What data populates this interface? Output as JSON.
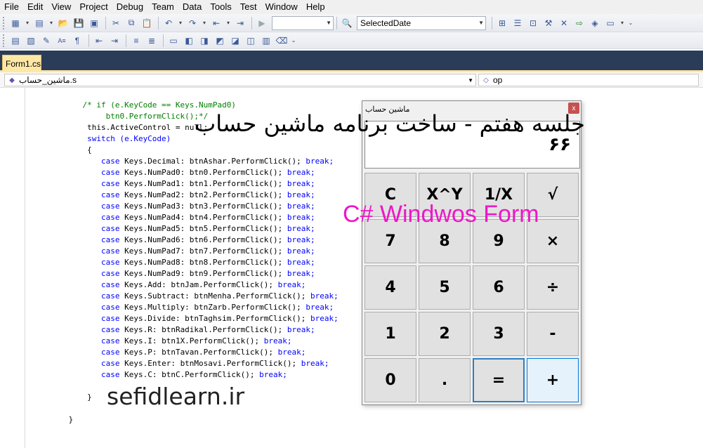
{
  "menu": [
    "File",
    "Edit",
    "View",
    "Project",
    "Debug",
    "Team",
    "Data",
    "Tools",
    "Test",
    "Window",
    "Help"
  ],
  "toolbar": {
    "property_combo_value": "SelectedDate"
  },
  "tab": {
    "label": "Form1.cs"
  },
  "nav": {
    "left_value": "ماشین_حساب.s",
    "right_value": "op"
  },
  "code_lines": [
    {
      "kind": "cmt",
      "text": "            /* if (e.KeyCode == Keys.NumPad0)"
    },
    {
      "kind": "cmt",
      "text": "                 btn0.PerformClick();*/"
    },
    {
      "kind": "plain",
      "text": "             this.ActiveControl = null;"
    },
    {
      "kind": "switch",
      "text": "             switch (e.KeyCode)"
    },
    {
      "kind": "plain",
      "text": "             {"
    },
    {
      "kind": "case",
      "text": "Keys.Decimal: btnAshar.PerformClick(); "
    },
    {
      "kind": "case",
      "text": "Keys.NumPad0: btn0.PerformClick(); "
    },
    {
      "kind": "case",
      "text": "Keys.NumPad1: btn1.PerformClick(); "
    },
    {
      "kind": "case",
      "text": "Keys.NumPad2: btn2.PerformClick(); "
    },
    {
      "kind": "case",
      "text": "Keys.NumPad3: btn3.PerformClick(); "
    },
    {
      "kind": "case",
      "text": "Keys.NumPad4: btn4.PerformClick(); "
    },
    {
      "kind": "case",
      "text": "Keys.NumPad5: btn5.PerformClick(); "
    },
    {
      "kind": "case",
      "text": "Keys.NumPad6: btn6.PerformClick(); "
    },
    {
      "kind": "case",
      "text": "Keys.NumPad7: btn7.PerformClick(); "
    },
    {
      "kind": "case",
      "text": "Keys.NumPad8: btn8.PerformClick(); "
    },
    {
      "kind": "case",
      "text": "Keys.NumPad9: btn9.PerformClick(); "
    },
    {
      "kind": "case",
      "text": "Keys.Add: btnJam.PerformClick(); "
    },
    {
      "kind": "case",
      "text": "Keys.Subtract: btnMenha.PerformClick(); "
    },
    {
      "kind": "case",
      "text": "Keys.Multiply: btnZarb.PerformClick(); "
    },
    {
      "kind": "case",
      "text": "Keys.Divide: btnTaghsim.PerformClick(); "
    },
    {
      "kind": "case",
      "text": "Keys.R: btnRadikal.PerformClick(); "
    },
    {
      "kind": "case",
      "text": "Keys.I: btn1X.PerformClick(); "
    },
    {
      "kind": "case",
      "text": "Keys.P: btnTavan.PerformClick(); "
    },
    {
      "kind": "case",
      "text": "Keys.Enter: btnMosavi.PerformClick(); "
    },
    {
      "kind": "case",
      "text": "Keys.C: btnC.PerformClick(); "
    },
    {
      "kind": "blank",
      "text": ""
    },
    {
      "kind": "plain",
      "text": "             }"
    },
    {
      "kind": "blank",
      "text": ""
    },
    {
      "kind": "plain",
      "text": "         }"
    }
  ],
  "code_keywords": {
    "case": "case",
    "break": "break;",
    "switch": "switch",
    "this": "this"
  },
  "calculator": {
    "title": "ماشین حساب",
    "close_label": "x",
    "display_value": "۶۶",
    "buttons": [
      "C",
      "X^Y",
      "1/X",
      "√",
      "7",
      "8",
      "9",
      "×",
      "4",
      "5",
      "6",
      "÷",
      "1",
      "2",
      "3",
      "-",
      "0",
      ".",
      "=",
      "+"
    ]
  },
  "overlay": {
    "title_fa": "جلسه هفتم - ساخت برنامه ماشین حساب",
    "subtitle": "C# Windwos Form",
    "site": "sefidlearn.ir"
  },
  "colors": {
    "tab_strip": "#2b3c59",
    "active_tab": "#ffe8a6",
    "keyword": "#0000ff",
    "comment": "#008000",
    "subtitle": "#ee16c8",
    "close_button": "#c75050"
  }
}
